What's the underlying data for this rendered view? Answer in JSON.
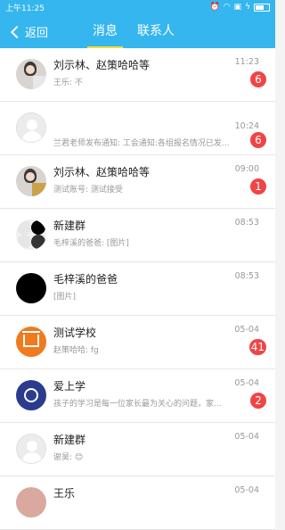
{
  "status_bar": {
    "time": "上午11:25",
    "icons": [
      "alarm-icon",
      "wifi-icon",
      "sim-icon",
      "charging-icon",
      "battery-icon"
    ]
  },
  "header": {
    "back_label": "返回",
    "tabs": [
      {
        "label": "消息",
        "active": true
      },
      {
        "label": "联系人",
        "active": false
      }
    ]
  },
  "colors": {
    "header_bg": "#35b6ef",
    "tab_underline": "#ffdd33",
    "badge": "#f04545"
  },
  "conversations": [
    {
      "name": "刘示林、赵策哈哈等",
      "preview": "王乐: 不",
      "time": "11:23",
      "badge": "6",
      "avatar": "group-photo"
    },
    {
      "name": "",
      "preview": "兰君老师发布通知: 工会通知:各组报名情况已发...",
      "time": "10:24",
      "badge": "6",
      "avatar": "default-user"
    },
    {
      "name": "刘示林、赵策哈哈等",
      "preview": "测试账号: 测试接受",
      "time": "09:00",
      "badge": "1",
      "avatar": "group-photo"
    },
    {
      "name": "新建群",
      "preview": "毛梓溪的爸爸: [图片]",
      "time": "08:53",
      "badge": "",
      "avatar": "group-mixed"
    },
    {
      "name": "毛梓溪的爸爸",
      "preview": "[图片]",
      "time": "08:53",
      "badge": "",
      "avatar": "black-circle"
    },
    {
      "name": "测试学校",
      "preview": "赵策哈哈: fg",
      "time": "05-04",
      "badge": "41",
      "avatar": "school-orange"
    },
    {
      "name": "爱上学",
      "preview": "孩子的学习是每一位家长最为关心的问题，家...",
      "time": "05-04",
      "badge": "2",
      "avatar": "app-logo-navy"
    },
    {
      "name": "新建群",
      "preview": "谢昊: 😊",
      "time": "05-04",
      "badge": "",
      "avatar": "default-user"
    },
    {
      "name": "王乐",
      "preview": "",
      "time": "05-04",
      "badge": "",
      "avatar": "photo"
    }
  ]
}
